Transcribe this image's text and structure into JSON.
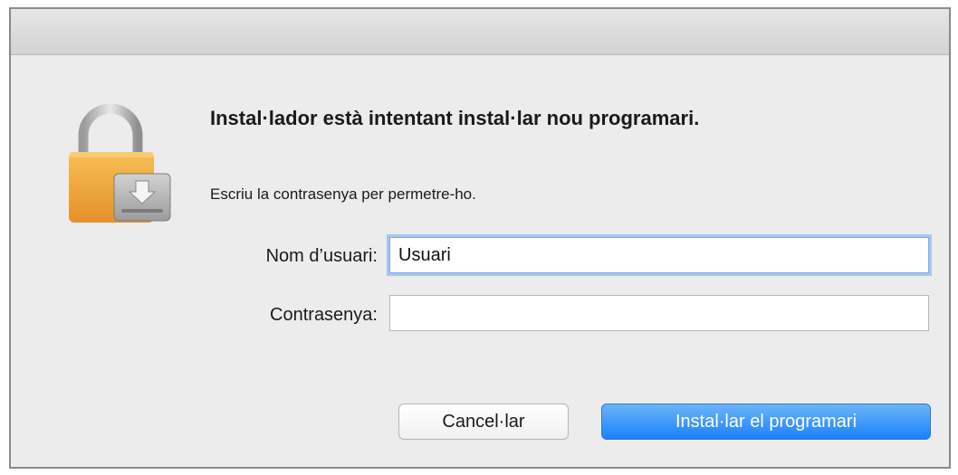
{
  "dialog": {
    "heading": "Instal·lador està intentant instal·lar nou programari.",
    "subtext": "Escriu la contrasenya per permetre-ho."
  },
  "form": {
    "username_label": "Nom d’usuari:",
    "username_value": "Usuari",
    "password_label": "Contrasenya:",
    "password_value": ""
  },
  "buttons": {
    "cancel_label": "Cancel·lar",
    "install_label": "Instal·lar el programari"
  },
  "icons": {
    "lock": "lock-with-installer-icon"
  },
  "colors": {
    "accent": "#1a82fb",
    "focus_ring": "#a8c6ee",
    "lock_gold": "#f0a33a"
  }
}
